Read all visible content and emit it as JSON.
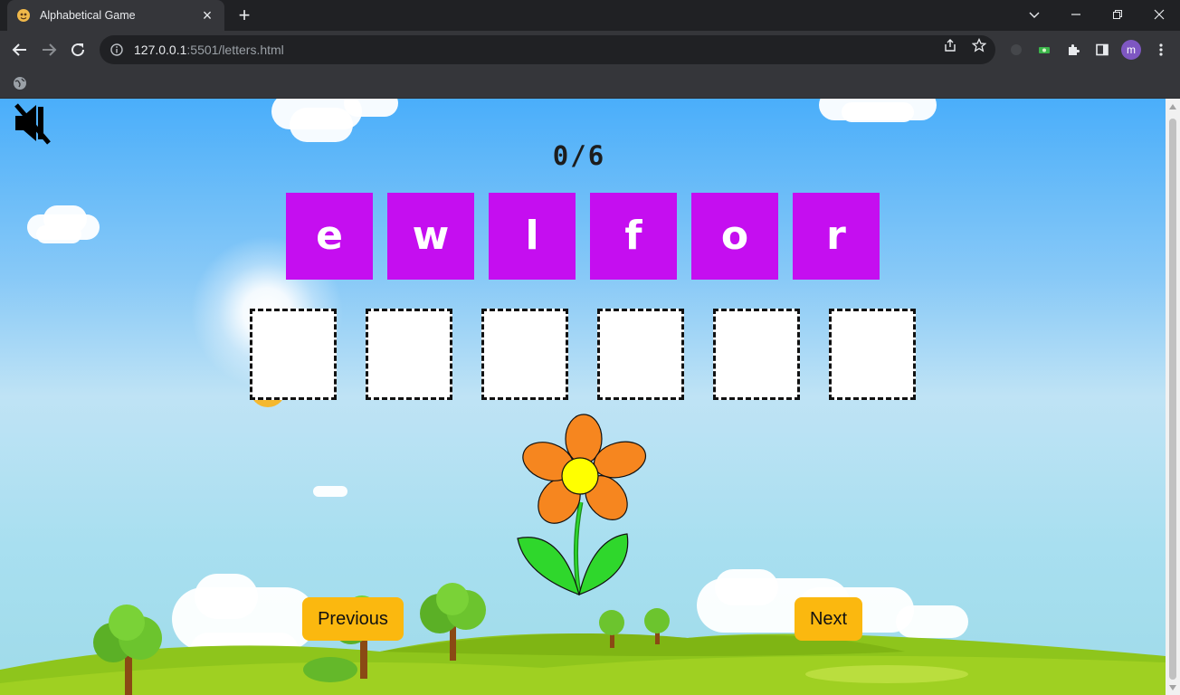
{
  "browser": {
    "tab_title": "Alphabetical Game",
    "url_host": "127.0.0.1",
    "url_path": ":5501/letters.html",
    "profile_initial": "m"
  },
  "game": {
    "score": "0/6",
    "letters": [
      "e",
      "w",
      "l",
      "f",
      "o",
      "r"
    ],
    "slots": [
      "",
      "",
      "",
      "",
      "",
      ""
    ],
    "sound": "muted",
    "picture": "flower"
  },
  "nav": {
    "previous_label": "Previous",
    "next_label": "Next"
  },
  "colors": {
    "tile": "#c50ef0",
    "button": "#fbb80f",
    "petal": "#f6861f",
    "flower_center": "#ffff00",
    "leaf": "#2fd72c"
  }
}
